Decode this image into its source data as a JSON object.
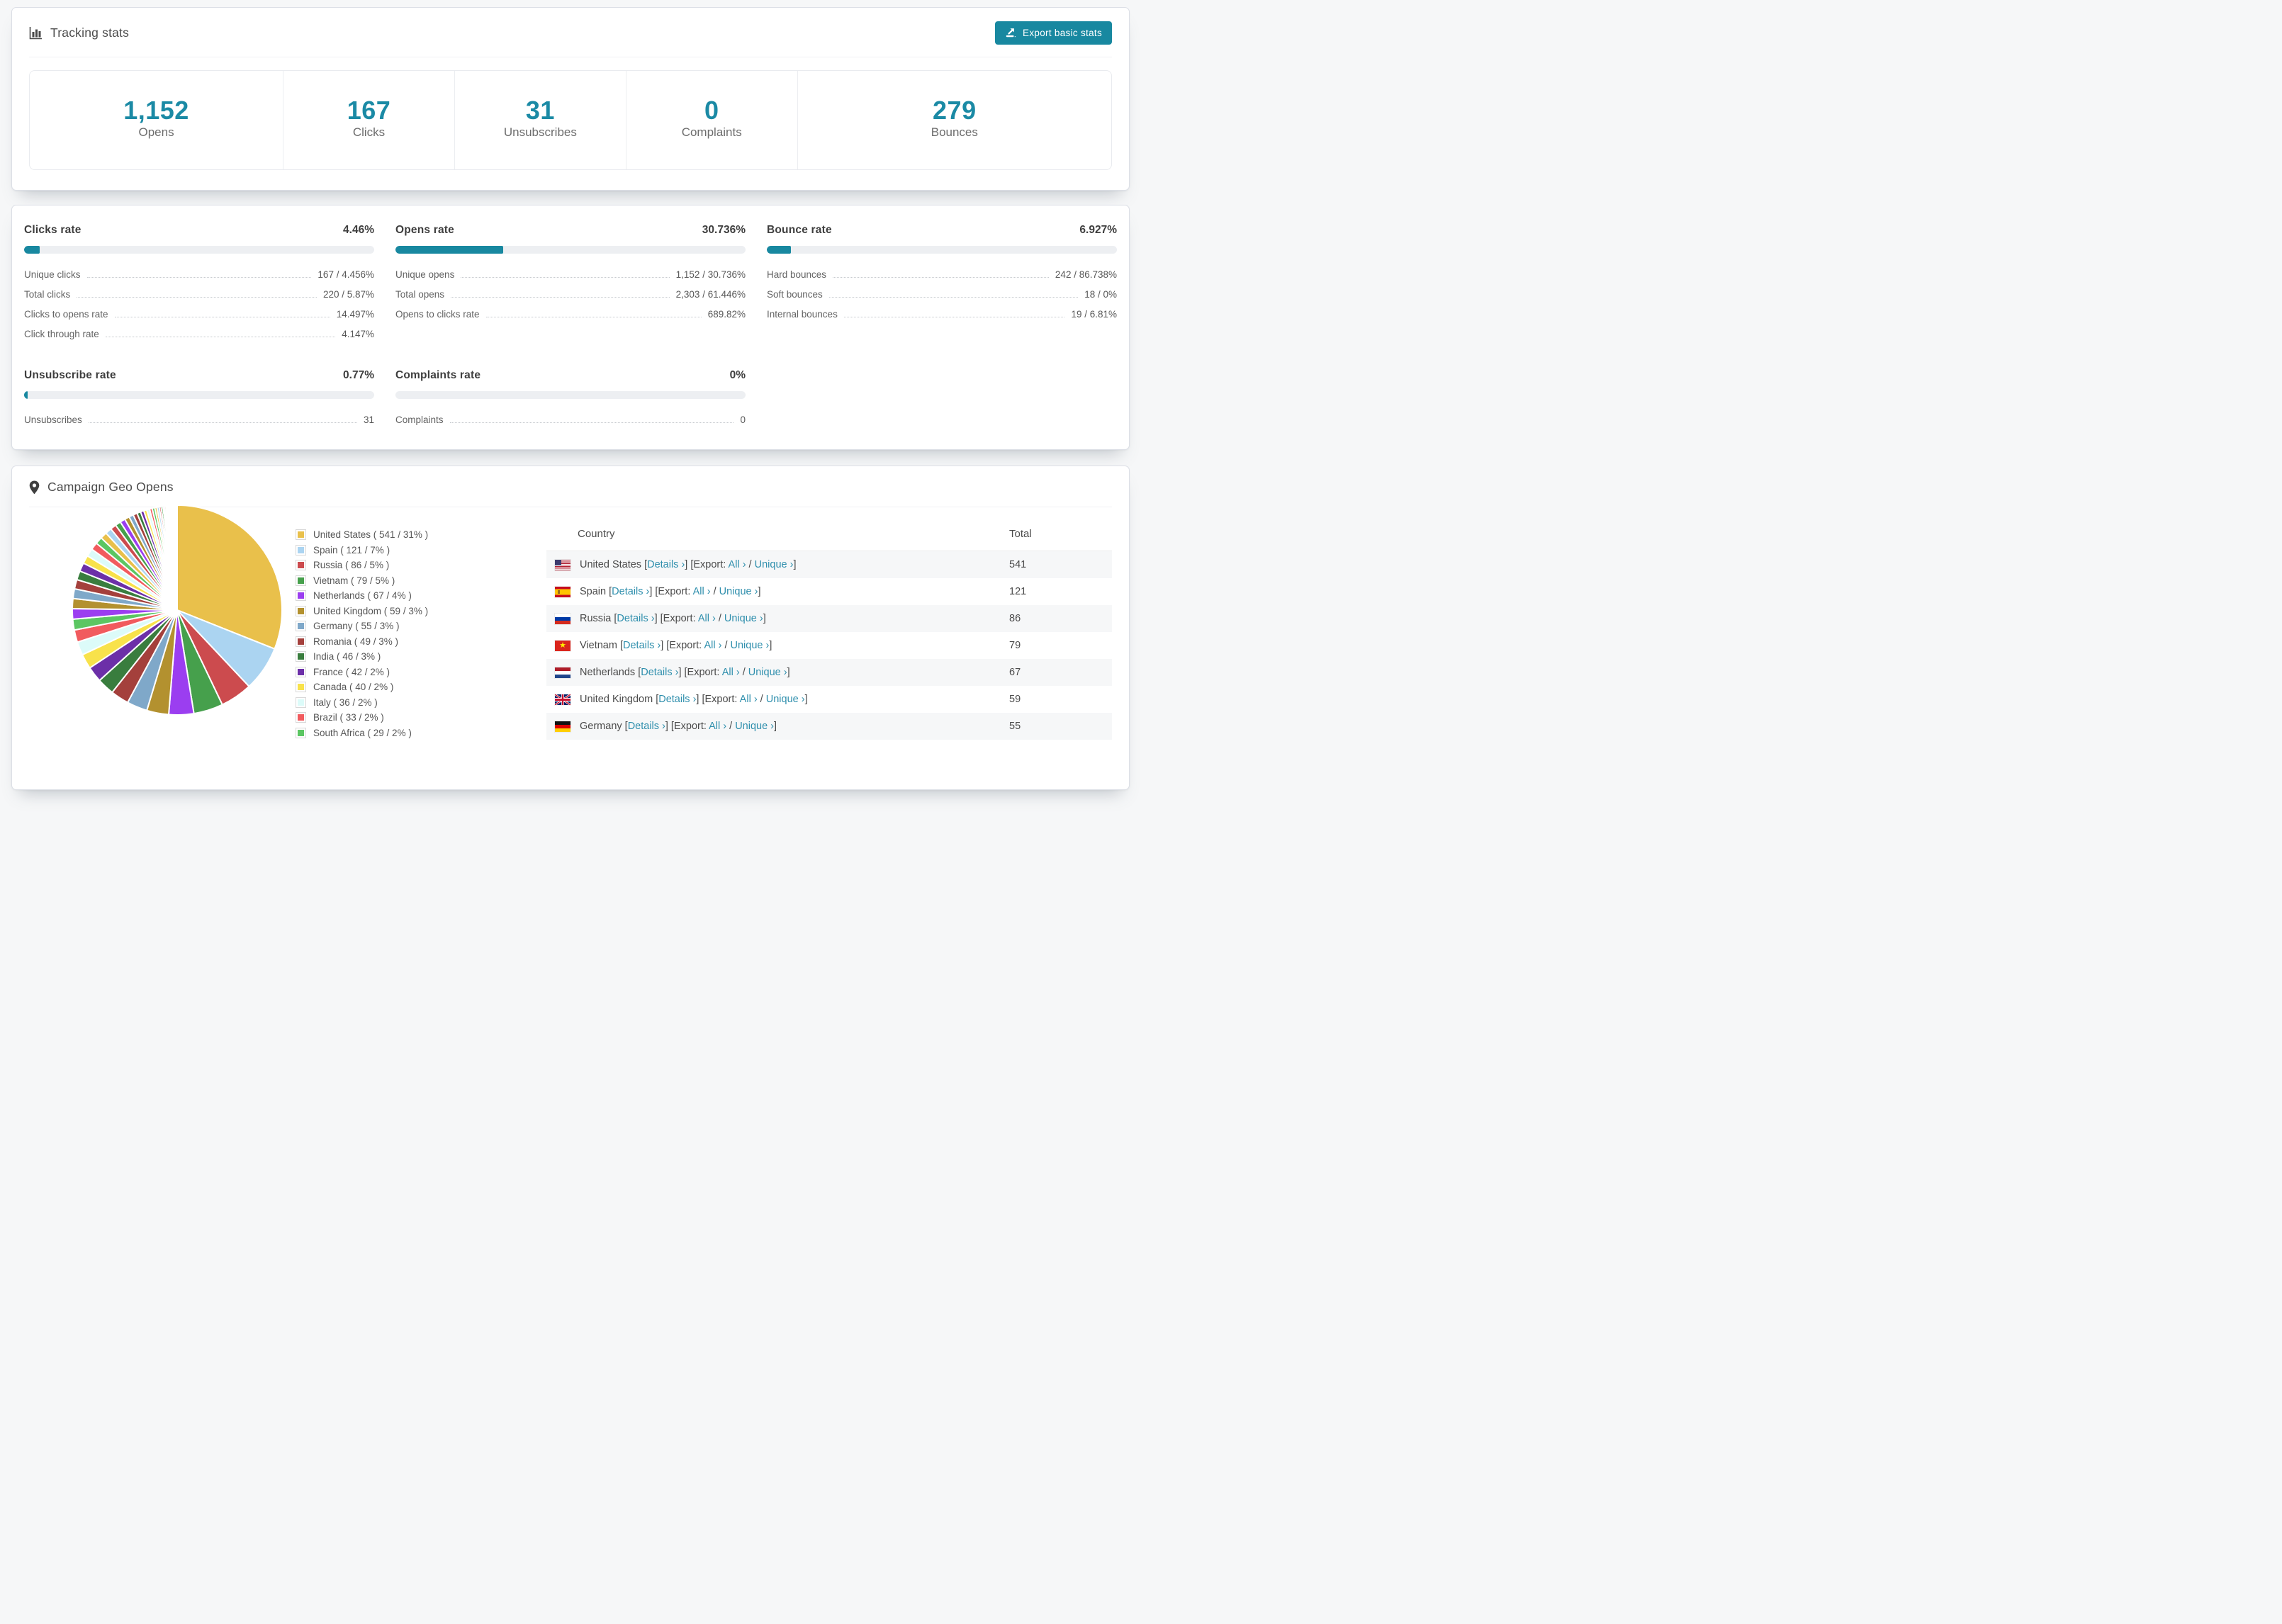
{
  "colors": {
    "accent": "#1b8aa5",
    "button": "#1888a0",
    "link": "#2f8fad",
    "bar_track": "#edeff2"
  },
  "tracking": {
    "title": "Tracking stats",
    "export_button": "Export basic stats",
    "stats": [
      {
        "value": "1,152",
        "label": "Opens"
      },
      {
        "value": "167",
        "label": "Clicks"
      },
      {
        "value": "31",
        "label": "Unsubscribes"
      },
      {
        "value": "0",
        "label": "Complaints"
      },
      {
        "value": "279",
        "label": "Bounces"
      }
    ]
  },
  "rates": [
    {
      "title": "Clicks rate",
      "value": "4.46%",
      "pct": 4.46,
      "rows": [
        {
          "label": "Unique clicks",
          "value": "167 / 4.456%"
        },
        {
          "label": "Total clicks",
          "value": "220 / 5.87%"
        },
        {
          "label": "Clicks to opens rate",
          "value": "14.497%"
        },
        {
          "label": "Click through rate",
          "value": "4.147%"
        }
      ]
    },
    {
      "title": "Opens rate",
      "value": "30.736%",
      "pct": 30.736,
      "rows": [
        {
          "label": "Unique opens",
          "value": "1,152 / 30.736%"
        },
        {
          "label": "Total opens",
          "value": "2,303 / 61.446%"
        },
        {
          "label": "Opens to clicks rate",
          "value": "689.82%"
        }
      ]
    },
    {
      "title": "Bounce rate",
      "value": "6.927%",
      "pct": 6.927,
      "rows": [
        {
          "label": "Hard bounces",
          "value": "242 / 86.738%"
        },
        {
          "label": "Soft bounces",
          "value": "18 / 0%"
        },
        {
          "label": "Internal bounces",
          "value": "19 / 6.81%"
        }
      ]
    },
    {
      "title": "Unsubscribe rate",
      "value": "0.77%",
      "pct": 0.77,
      "rows": [
        {
          "label": "Unsubscribes",
          "value": "31"
        }
      ]
    },
    {
      "title": "Complaints rate",
      "value": "0%",
      "pct": 0,
      "rows": [
        {
          "label": "Complaints",
          "value": "0"
        }
      ]
    }
  ],
  "geo": {
    "title": "Campaign Geo Opens",
    "table": {
      "col_country": "Country",
      "col_total": "Total",
      "link_details": "Details ›",
      "label_export": "Export:",
      "link_all": "All ›",
      "link_unique": "Unique ›",
      "lb": "[",
      "rb": "]",
      "slash": "/",
      "rows": [
        {
          "flag": "us",
          "country": "United States",
          "total": "541"
        },
        {
          "flag": "es",
          "country": "Spain",
          "total": "121"
        },
        {
          "flag": "ru",
          "country": "Russia",
          "total": "86"
        },
        {
          "flag": "vn",
          "country": "Vietnam",
          "total": "79"
        },
        {
          "flag": "nl",
          "country": "Netherlands",
          "total": "67"
        },
        {
          "flag": "gb",
          "country": "United Kingdom",
          "total": "59"
        },
        {
          "flag": "de",
          "country": "Germany",
          "total": "55"
        }
      ]
    }
  },
  "chart_data": {
    "type": "pie",
    "title": "Campaign Geo Opens",
    "legend_position": "right of pie",
    "start_angle_deg": -90,
    "direction": "clockwise",
    "slices": [
      {
        "label": "United States",
        "value": 541,
        "pct": 31,
        "color": "#e9c04b"
      },
      {
        "label": "Spain",
        "value": 121,
        "pct": 7,
        "color": "#abd4f1"
      },
      {
        "label": "Russia",
        "value": 86,
        "pct": 5,
        "color": "#cc4b4e"
      },
      {
        "label": "Vietnam",
        "value": 79,
        "pct": 5,
        "color": "#46a04c"
      },
      {
        "label": "Netherlands",
        "value": 67,
        "pct": 4,
        "color": "#9b3ef0"
      },
      {
        "label": "United Kingdom",
        "value": 59,
        "pct": 3,
        "color": "#b3912f"
      },
      {
        "label": "Germany",
        "value": 55,
        "pct": 3,
        "color": "#7fa8c9"
      },
      {
        "label": "Romania",
        "value": 49,
        "pct": 3,
        "color": "#a4403c"
      },
      {
        "label": "India",
        "value": 46,
        "pct": 3,
        "color": "#397d3e"
      },
      {
        "label": "France",
        "value": 42,
        "pct": 2,
        "color": "#6c2fa8"
      },
      {
        "label": "Canada",
        "value": 40,
        "pct": 2,
        "color": "#f8e24b"
      },
      {
        "label": "Italy",
        "value": 36,
        "pct": 2,
        "color": "#dcfbf9"
      },
      {
        "label": "Brazil",
        "value": 33,
        "pct": 2,
        "color": "#f15b5e"
      },
      {
        "label": "South Africa",
        "value": 29,
        "pct": 2,
        "color": "#5bc662"
      }
    ],
    "other_unlabeled_values": [
      28,
      27,
      26,
      25,
      24,
      23,
      22,
      21,
      20,
      19,
      18,
      17,
      16,
      15,
      14,
      13,
      12,
      11,
      10,
      9,
      8,
      8,
      7,
      7,
      6,
      6,
      5,
      5,
      4,
      4,
      3,
      3,
      3,
      2,
      2,
      2,
      2,
      2,
      1,
      1,
      1,
      1,
      1,
      1,
      1,
      1,
      1,
      1,
      1
    ]
  }
}
